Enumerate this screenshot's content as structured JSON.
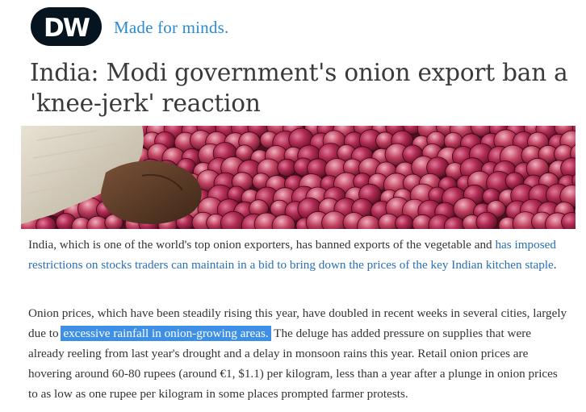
{
  "brand": {
    "logo_text": "DW",
    "tagline": "Made for minds.",
    "colors": {
      "logo_dark": "#05141f",
      "tagline_blue": "#2a8cd1",
      "link_blue": "#2a6fb5",
      "selection_blue": "#3d8fe8"
    }
  },
  "article": {
    "headline": "India: Modi government's onion export ban a 'knee-jerk' reaction",
    "image": {
      "subject": "onion-pile-photo"
    },
    "paragraph1": {
      "text_before_link": "India, which is one of the world's top onion exporters, has banned exports of the vegetable and ",
      "link_text": "has imposed restrictions on stocks traders can maintain in a bid to bring down the prices of the key Indian kitchen staple",
      "text_after_link": "."
    },
    "paragraph2": {
      "text_before_highlight": "Onion prices, which have been steadily rising this year, have doubled in recent weeks in several cities, largely due to ",
      "highlighted_text": "excessive rainfall in onion-growing areas.",
      "text_after_highlight": " The deluge has added pressure on supplies that were already reeling from last year's drought and a delay in monsoon rains this year.  Retail onion prices are hovering around 60-80 rupees (around €1, $1.1) per kilogram, less than a year after a plunge in onion prices to as low as one rupee per kilogram in some places prompted farmer protests."
    }
  }
}
